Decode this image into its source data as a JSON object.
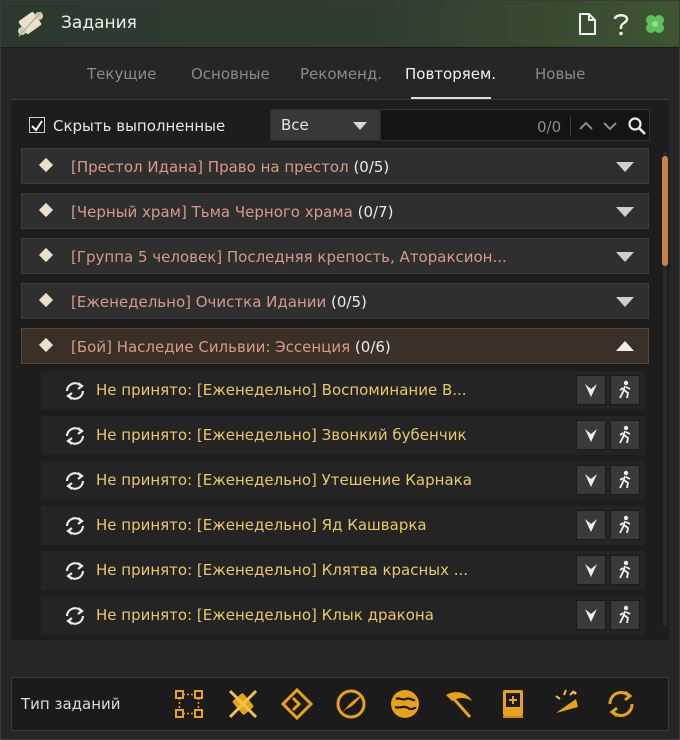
{
  "window": {
    "title": "Задания"
  },
  "tabs": [
    {
      "label": "Текущие"
    },
    {
      "label": "Основные"
    },
    {
      "label": "Рекоменд."
    },
    {
      "label": "Повторяем."
    },
    {
      "label": "Новые"
    }
  ],
  "active_tab": "Повторяем.",
  "filter": {
    "hide_completed_label": "Скрыть выполненные",
    "hide_completed_checked": true,
    "dropdown_value": "Все",
    "search_count": "0/0"
  },
  "quests": [
    {
      "title": "[Престол Идана] Право на престол",
      "count": "(0/5)",
      "expanded": false
    },
    {
      "title": "[Черный храм] Тьма Черного храма",
      "count": "(0/7)",
      "expanded": false
    },
    {
      "title": "[Группа 5 человек] Последняя крепость, Атораксион...",
      "count": "",
      "expanded": false
    },
    {
      "title": "[Еженедельно] Очистка Идании",
      "count": "(0/5)",
      "expanded": false
    },
    {
      "title": "[Бой] Наследие Сильвии: Эссенция",
      "count": "(0/6)",
      "expanded": true
    }
  ],
  "subquests": [
    {
      "text": "Не принято: [Еженедельно] Воспоминание В..."
    },
    {
      "text": "Не принято: [Еженедельно] Звонкий бубенчик"
    },
    {
      "text": "Не принято: [Еженедельно] Утешение Карнака"
    },
    {
      "text": "Не принято: [Еженедельно] Яд Кашварка"
    },
    {
      "text": "Не принято: [Еженедельно] Клятва красных ..."
    },
    {
      "text": "Не принято: [Еженедельно] Клык дракона"
    }
  ],
  "bottom": {
    "label": "Тип заданий",
    "icons": [
      "nodes-icon",
      "scroll-sword-icon",
      "diamond-arrow-icon",
      "feather-circle-icon",
      "globe-icon",
      "scythe-icon",
      "book-icon",
      "horn-icon",
      "repeat-icon"
    ]
  },
  "colors": {
    "quest_title": "#d69a86",
    "subquest_text": "#e8c86a",
    "accent_gold": "#e8a21a",
    "scroll_thumb": "#c8824a"
  }
}
